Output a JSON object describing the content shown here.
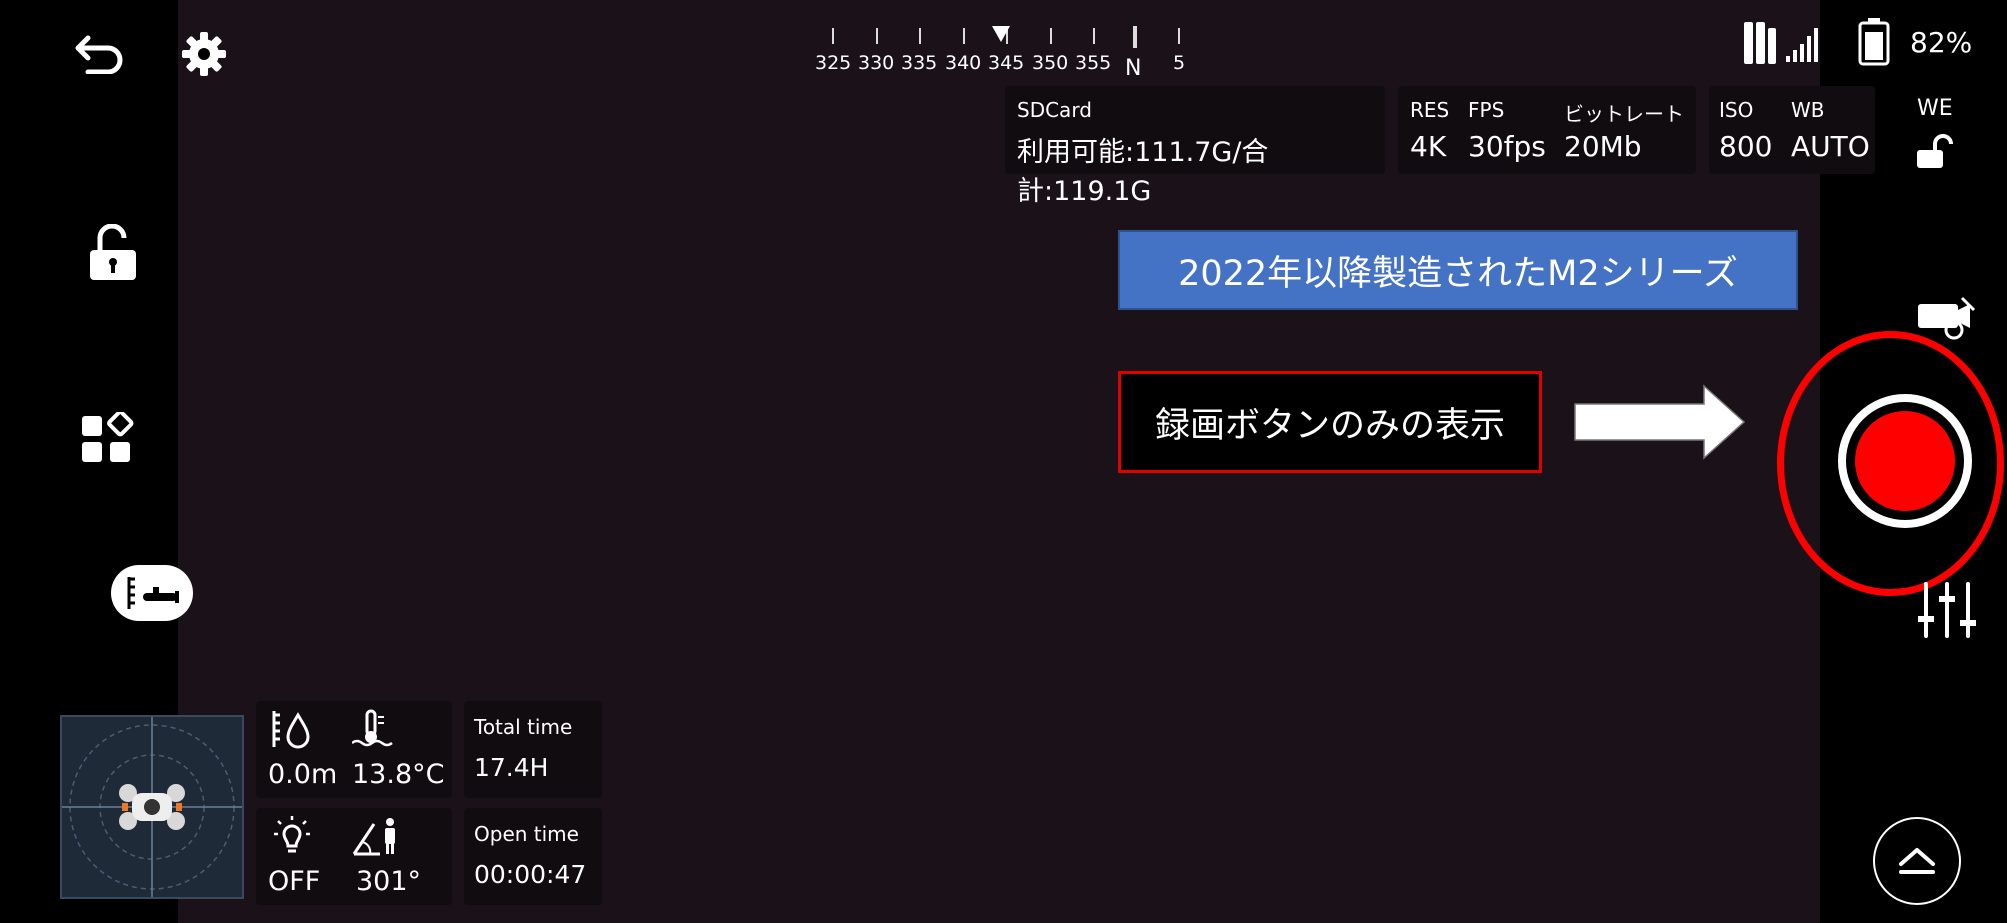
{
  "compass": {
    "numbers": [
      "325",
      "330",
      "335",
      "340",
      "345",
      "350",
      "355",
      "N",
      "5"
    ]
  },
  "status": {
    "battery_percent": "82%"
  },
  "sdcard": {
    "title": "SDCard",
    "value": "利用可能:111.7G/合計:119.1G"
  },
  "video": {
    "res_label": "RES",
    "res_value": "4K",
    "fps_label": "FPS",
    "fps_value": "30fps",
    "bitrate_label": "ビットレート",
    "bitrate_value": "20Mb"
  },
  "camera": {
    "iso_label": "ISO",
    "iso_value": "800",
    "wb_label": "WB",
    "wb_value": "AUTO",
    "we_label": "WE"
  },
  "annotations": {
    "blue_box_text": "2022年以降製造されたM2シリーズ",
    "red_box_text": "録画ボタンのみの表示"
  },
  "telemetry": {
    "depth": "0.0m",
    "temperature": "13.8°C",
    "light": "OFF",
    "angle": "301°",
    "total_time_label": "Total time",
    "total_time_value": "17.4H",
    "open_time_label": "Open time",
    "open_time_value": "00:00:47"
  },
  "colors": {
    "record_red": "#ff0000",
    "annotation_blue": "#4472c4",
    "annotation_red_border": "#e00000"
  }
}
